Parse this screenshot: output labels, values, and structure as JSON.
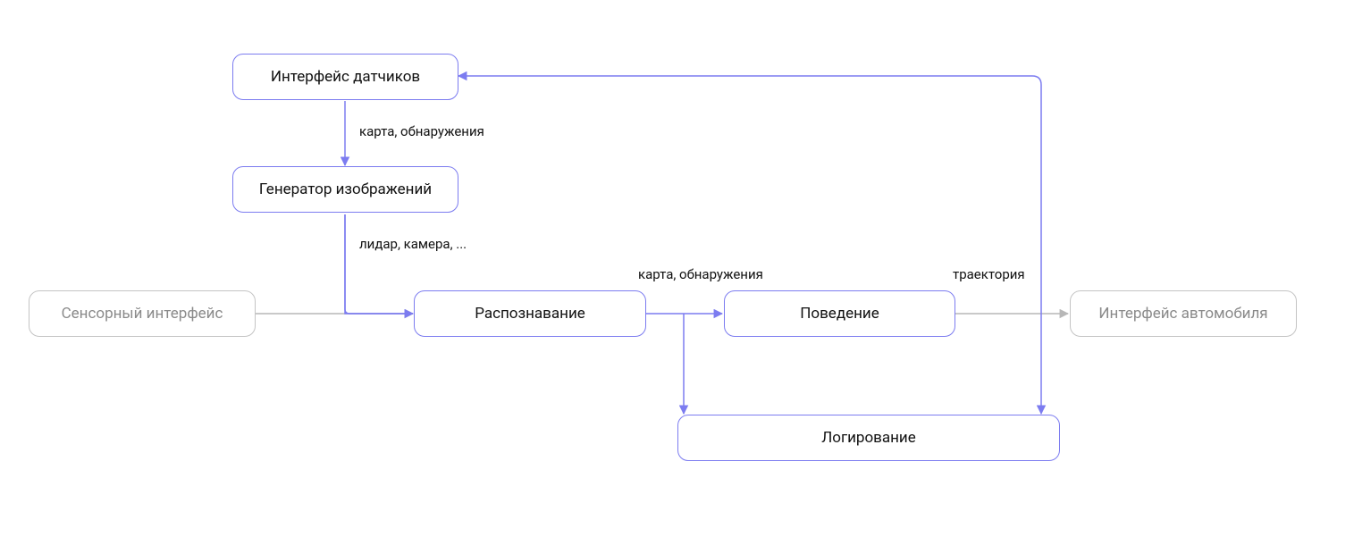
{
  "nodes": {
    "sensor_iface": "Сенсорный интерфейс",
    "datchik_iface": "Интерфейс датчиков",
    "img_gen": "Генератор изображений",
    "recognition": "Распознавание",
    "behavior": "Поведение",
    "vehicle_iface": "Интерфейс автомобиля",
    "logging": "Логирование"
  },
  "edges": {
    "map_detections_1": "карта, обнаружения",
    "lidar_camera": "лидар, камера, ...",
    "map_detections_2": "карта, обнаружения",
    "trajectory": "траектория"
  },
  "colors": {
    "primary": "#7c7cf0",
    "secondary": "#b7b7b7"
  }
}
